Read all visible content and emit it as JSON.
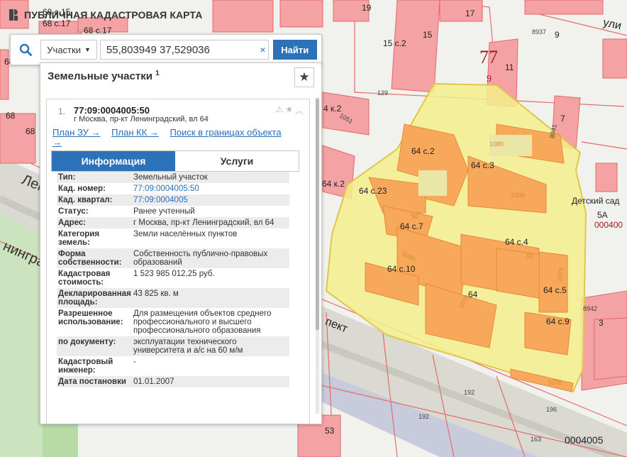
{
  "brand": {
    "title": "ПУБЛИЧНАЯ КАДАСТРОВАЯ КАРТА"
  },
  "search": {
    "type_label": "Участки",
    "value": "55,803949 37,529036",
    "clear_label": "×",
    "button_label": "Найти"
  },
  "panel": {
    "title": "Земельные участки",
    "count": "1",
    "result": {
      "number": "1.",
      "cadastral": "77:09:0004005:50",
      "address": "г Москва, пр-кт Ленинградский, вл 64",
      "links": [
        "План ЗУ →",
        "План КК →",
        "Поиск в границах объекта →"
      ],
      "tabs": [
        "Информация",
        "Услуги"
      ],
      "rows": [
        {
          "k": "Тип:",
          "v": "Земельный участок"
        },
        {
          "k": "Кад. номер:",
          "v": "77:09:0004005:50"
        },
        {
          "k": "Кад. квартал:",
          "v": "77:09:0004005"
        },
        {
          "k": "Статус:",
          "v": "Ранее учтенный"
        },
        {
          "k": "Адрес:",
          "v": "г Москва, пр-кт Ленинградский, вл 64"
        },
        {
          "k": "Категория земель:",
          "v": "Земли населённых пунктов"
        },
        {
          "k": "Форма собственности:",
          "v": "Собственность публично-правовых образований"
        },
        {
          "k": "Кадастровая стоимость:",
          "v": "1 523 985 012,25 руб."
        },
        {
          "k": "Декларированная площадь:",
          "v": "43 825 кв. м"
        },
        {
          "k": "Разрешенное использование:",
          "v": "Для размещения объектов среднего профессионального и высшего профессионального образования"
        },
        {
          "k": "по документу:",
          "v": "эксплуатации технического университета и а/с на 60 м/м"
        },
        {
          "k": "Кадастровый инженер:",
          "v": "-"
        },
        {
          "k": "Дата постановки",
          "v": "01.01.2007"
        }
      ]
    }
  },
  "map_labels": {
    "b68c15": "68 с.15",
    "b68c17": "68 с.17",
    "b68a": "68",
    "b68b": "68",
    "b68c": "68",
    "b19": "19",
    "b17": "17",
    "b15": "15",
    "b15c2": "15 с.2",
    "b11": "11",
    "b9": "9",
    "b7": "7",
    "b8937": "8937",
    "quarter77": "77",
    "quarter9": "9",
    "b64c2": "64 с.2",
    "b64c3": "64 с.3",
    "b64c23": "64 с.23",
    "b64c7": "64 с.7",
    "b64c4": "64 с.4",
    "b64c10": "64 с.10",
    "b64": "64",
    "b64c5": "64 с.5",
    "b64c9": "64 с.9",
    "b64k2": "64 к.2",
    "b4k2": "4 к.2",
    "kindergarten": "Детский сад",
    "b5a": "5А",
    "q0004005a": "000400",
    "q0004005b": "0004005",
    "b8942": "8942",
    "b3": "3",
    "b129": "129",
    "b53": "53",
    "b192a": "192",
    "b192b": "192",
    "b196": "196",
    "b163": "163",
    "b8941": "8941",
    "b1080": "1080",
    "b1006": "1006",
    "b1075": "1075",
    "b1078": "1078",
    "b1076": "1076",
    "b1090": "1090",
    "b50a": "50",
    "b50b": "50",
    "b1051": "1051",
    "street_len": "Лен",
    "street_ingr": "нинград",
    "street_pekt": "пект",
    "street_ul": "ули"
  }
}
